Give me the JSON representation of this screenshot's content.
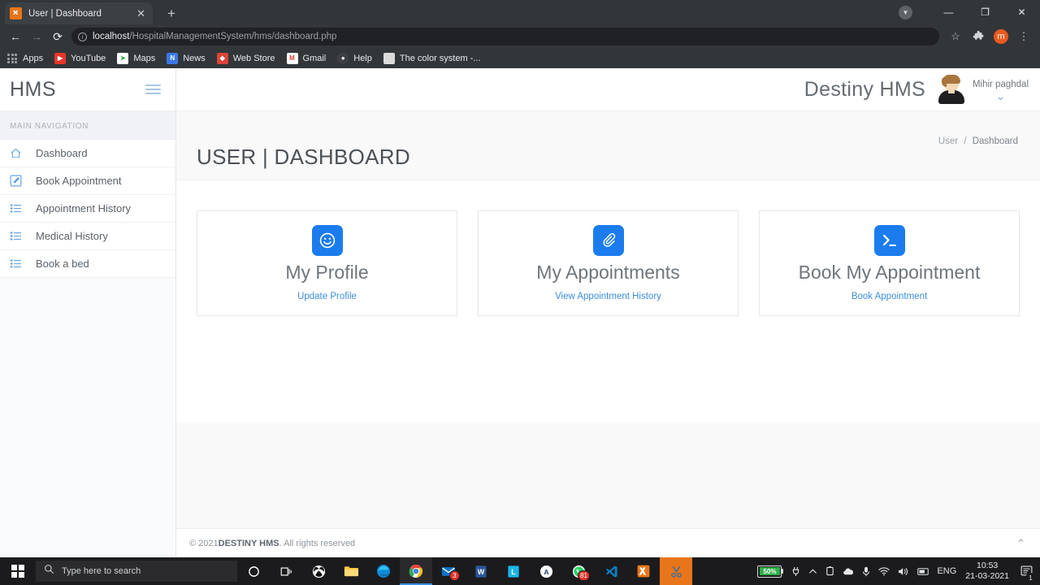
{
  "browser": {
    "tab": {
      "title": "User | Dashboard",
      "favicon": "xampp-icon",
      "close": "✕"
    },
    "newtab_label": "+",
    "nav": {
      "back": "←",
      "forward": "→",
      "reload": "⟳"
    },
    "omnibox": {
      "info_glyph": "i",
      "url_host": "localhost",
      "url_path": "/HospitalManagementSystem/hms/dashboard.php"
    },
    "actions": {
      "bookmark_star": "☆",
      "extensions": "❖",
      "profile_initial": "m",
      "menu": "⋮"
    },
    "window": {
      "profile_chip": "▼",
      "minimize": "—",
      "maximize": "❐",
      "close": "✕"
    },
    "bookmarks": [
      {
        "label": "Apps",
        "icon": "apps-grid-icon",
        "color": "#9aa0a6",
        "glyph": ""
      },
      {
        "label": "YouTube",
        "icon": "youtube-icon",
        "color": "#e8352a",
        "glyph": "▶"
      },
      {
        "label": "Maps",
        "icon": "maps-icon",
        "color": "#34a853",
        "glyph": "➤"
      },
      {
        "label": "News",
        "icon": "news-icon",
        "color": "#3b78e7",
        "glyph": "N"
      },
      {
        "label": "Web Store",
        "icon": "web-store-icon",
        "color": "#db4437",
        "glyph": "◆"
      },
      {
        "label": "Gmail",
        "icon": "gmail-icon",
        "color": "#ffffff",
        "glyph": "M"
      },
      {
        "label": "Help",
        "icon": "help-globe-icon",
        "color": "#3c4043",
        "glyph": "●"
      },
      {
        "label": "The color system -...",
        "icon": "color-system-icon",
        "color": "#dcdcdc",
        "glyph": ""
      }
    ]
  },
  "sidebar": {
    "logo": "HMS",
    "toggle_icon": "hamburger-icon",
    "nav_header": "MAIN NAVIGATION",
    "items": [
      {
        "label": "Dashboard",
        "icon": "home-icon"
      },
      {
        "label": "Book Appointment",
        "icon": "edit-pencil-icon"
      },
      {
        "label": "Appointment History",
        "icon": "list-icon"
      },
      {
        "label": "Medical History",
        "icon": "list-icon"
      },
      {
        "label": "Book a bed",
        "icon": "list-icon"
      }
    ]
  },
  "topbar": {
    "brand": "Destiny HMS",
    "user_name": "Mihir paghdal",
    "avatar_icon": "user-avatar",
    "caret_icon": "chevron-down-icon"
  },
  "content": {
    "page_title": "USER | DASHBOARD",
    "breadcrumb": {
      "root": "User",
      "separator": "/",
      "current": "Dashboard"
    },
    "settings_tab_icon": "gear-icon",
    "cards": [
      {
        "icon": "smiley-face-icon",
        "glyph": "☺",
        "title": "My Profile",
        "link": "Update Profile",
        "accent": "#1b7ced"
      },
      {
        "icon": "paperclip-icon",
        "glyph": "📎",
        "title": "My Appointments",
        "link": "View Appointment History",
        "accent": "#1b7ced"
      },
      {
        "icon": "terminal-icon",
        "glyph": ">_",
        "title": "Book My Appointment",
        "link": "Book Appointment",
        "accent": "#1b7ced"
      }
    ]
  },
  "footer": {
    "copyright_prefix": "© 2021",
    "brand": "DESTINY HMS",
    "rights": "All rights reserved",
    "scroll_top_icon": "chevron-up-icon"
  },
  "taskbar": {
    "start_icon": "windows-start-icon",
    "search_placeholder": "Type here to search",
    "search_icon": "search-icon",
    "items": [
      {
        "name": "cortana-icon",
        "glyph": "○",
        "color": "#ffffff",
        "badge": ""
      },
      {
        "name": "task-view-icon",
        "glyph": "⧉",
        "color": "#ffffff",
        "badge": ""
      },
      {
        "name": "xbox-icon",
        "glyph": "✕",
        "color": "#107c10",
        "badge": ""
      },
      {
        "name": "file-explorer-icon",
        "glyph": "🗀",
        "color": "#ffc83d",
        "badge": ""
      },
      {
        "name": "microsoft-edge-icon",
        "glyph": "◔",
        "color": "#0f8bd6",
        "badge": ""
      },
      {
        "name": "google-chrome-icon",
        "glyph": "◉",
        "color": "#ea4335",
        "badge": "",
        "active": true
      },
      {
        "name": "mail-icon",
        "glyph": "✉",
        "color": "#0a72c4",
        "badge": "3"
      },
      {
        "name": "word-icon",
        "glyph": "W",
        "color": "#2b579a",
        "badge": ""
      },
      {
        "name": "lightshot-icon",
        "glyph": "L",
        "color": "#19b5e8",
        "badge": ""
      },
      {
        "name": "adobe-icon",
        "glyph": "A",
        "color": "#ffffff",
        "badge": ""
      },
      {
        "name": "whatsapp-icon",
        "glyph": "✆",
        "color": "#25d366",
        "badge": "81"
      },
      {
        "name": "vscode-icon",
        "glyph": "◀",
        "color": "#0b7ec4",
        "badge": ""
      },
      {
        "name": "xampp-icon",
        "glyph": "⌘",
        "color": "#e8751a",
        "badge": ""
      },
      {
        "name": "snipping-tool-icon",
        "glyph": "✂",
        "color": "#4a90d9",
        "badge": "",
        "highlight": true
      }
    ],
    "tray": {
      "battery_percent": "50%",
      "battery_icon": "battery-icon",
      "plug_icon": "power-plug-icon",
      "overflow_icon": "show-hidden-icons-chevron",
      "onedrive_icon": "onedrive-icon",
      "device_icon": "device-icon",
      "mic_icon": "microphone-icon",
      "network_icon": "wifi-icon",
      "volume_icon": "speaker-icon",
      "language": "ENG",
      "time": "10:53",
      "date": "21-03-2021",
      "action_center_icon": "action-center-icon",
      "action_center_badge": "1"
    }
  }
}
